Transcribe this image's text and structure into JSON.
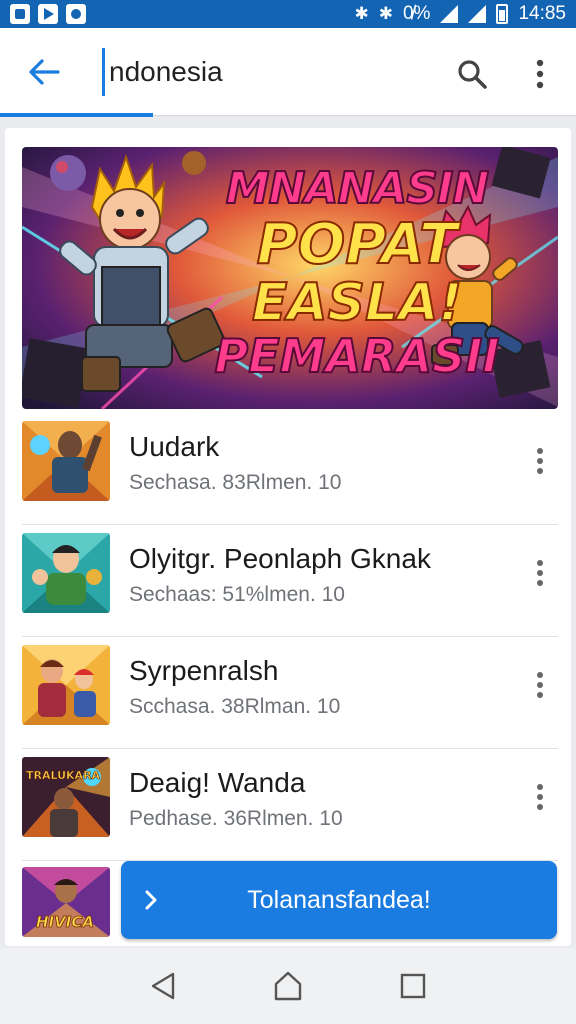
{
  "status_bar": {
    "icons": [
      "app-icon",
      "play-store-icon",
      "sync-icon"
    ],
    "signal_text": "0̸%",
    "time": "14:85"
  },
  "app_bar": {
    "search_query": "ndonesia",
    "back_icon": "arrow-left-icon",
    "search_icon": "search-icon",
    "more_icon": "more-vertical-icon"
  },
  "banner": {
    "line1": "MNANASIN",
    "line2": "POPAT",
    "line3": "EASLA!",
    "line4": "PEMARASII"
  },
  "games": [
    {
      "title": "Uudark",
      "meta": "Sechasa.  83Rlmen.  10"
    },
    {
      "title": "Olyitgr. Peonlaph Gknak",
      "meta": "Sechaas:  51%lmen.  10"
    },
    {
      "title": "Syrpenralsh",
      "meta": "Scchasa.  38Rlman.  10"
    },
    {
      "title": "Deaig! Wanda",
      "meta": "Pedhase.  36Rlmen.  10"
    }
  ],
  "cta": {
    "label": "Tolanansfandea!"
  },
  "thumb_labels": {
    "row4": "TRALUKARA",
    "row5": "HIVICA"
  },
  "colors": {
    "accent": "#1a7be0",
    "status_bar": "#1464b4"
  }
}
